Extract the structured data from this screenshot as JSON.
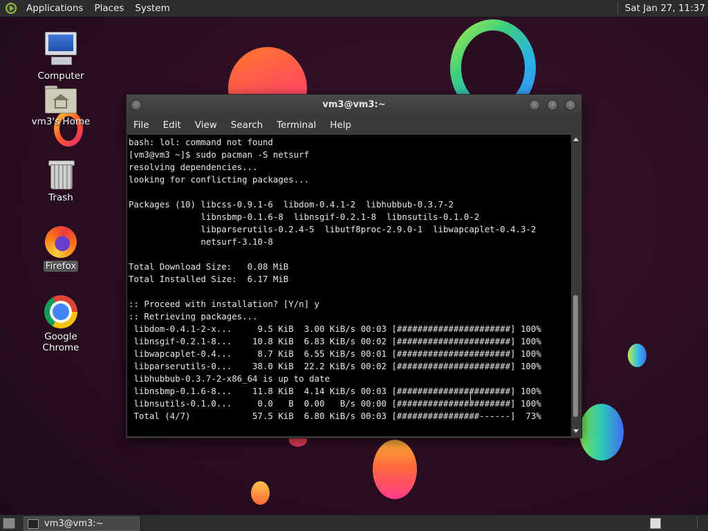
{
  "top_panel": {
    "menus": [
      "Applications",
      "Places",
      "System"
    ],
    "clock": "Sat Jan 27, 11:37"
  },
  "desktop_icons": [
    {
      "label": "Computer",
      "icon": "computer-icon"
    },
    {
      "label": "vm3's Home",
      "icon": "home-folder-icon"
    },
    {
      "label": "Trash",
      "icon": "trash-icon"
    },
    {
      "label": "Firefox",
      "icon": "firefox-icon"
    },
    {
      "label": "Google Chrome",
      "icon": "chrome-icon"
    }
  ],
  "terminal": {
    "title": "vm3@vm3:~",
    "menus": [
      "File",
      "Edit",
      "View",
      "Search",
      "Terminal",
      "Help"
    ],
    "lines": [
      "bash: lol: command not found",
      "[vm3@vm3 ~]$ sudo pacman -S netsurf",
      "resolving dependencies...",
      "looking for conflicting packages...",
      "",
      "Packages (10) libcss-0.9.1-6  libdom-0.4.1-2  libhubbub-0.3.7-2",
      "              libnsbmp-0.1.6-8  libnsgif-0.2.1-8  libnsutils-0.1.0-2",
      "              libparserutils-0.2.4-5  libutf8proc-2.9.0-1  libwapcaplet-0.4.3-2",
      "              netsurf-3.10-8",
      "",
      "Total Download Size:   0.08 MiB",
      "Total Installed Size:  6.17 MiB",
      "",
      ":: Proceed with installation? [Y/n] y",
      ":: Retrieving packages...",
      " libdom-0.4.1-2-x...     9.5 KiB  3.00 KiB/s 00:03 [######################] 100%",
      " libnsgif-0.2.1-8...    10.8 KiB  6.83 KiB/s 00:02 [######################] 100%",
      " libwapcaplet-0.4...     8.7 KiB  6.55 KiB/s 00:01 [######################] 100%",
      " libparserutils-0...    38.0 KiB  22.2 KiB/s 00:02 [######################] 100%",
      " libhubbub-0.3.7-2-x86_64 is up to date",
      " libnsbmp-0.1.6-8...    11.8 KiB  4.14 KiB/s 00:03 [######################] 100%",
      " libnsutils-0.1.0...     0.0   B  0.00   B/s 00:00 [######################] 100%",
      " Total (4/7)            57.5 KiB  6.80 KiB/s 00:03 [################------]  73%"
    ]
  },
  "taskbar": {
    "items": [
      {
        "label": "vm3@vm3:~",
        "icon": "terminal-icon"
      }
    ]
  }
}
